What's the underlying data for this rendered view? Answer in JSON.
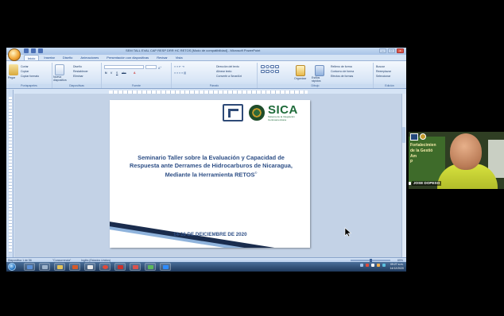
{
  "window": {
    "title": "SEM TALL EVAL CAP RESP DRR HC RETOS [Modo de compatibilidad] - Microsoft PowerPoint",
    "minimize": "–",
    "maximize": "□",
    "close": "x"
  },
  "ribbon": {
    "tabs": [
      "Inicio",
      "Insertar",
      "Diseño",
      "Animaciones",
      "Presentación con diapositivas",
      "Revisar",
      "Vista"
    ],
    "active_tab": "Inicio",
    "groups": {
      "clipboard": {
        "label": "Portapapeles",
        "paste": "Pegar",
        "cut": "Cortar",
        "copy": "Copiar",
        "format_painter": "Copiar formato"
      },
      "slides": {
        "label": "Diapositivas",
        "new_slide": "Nueva diapositiva",
        "layout": "Diseño",
        "reset": "Restablecer",
        "delete": "Eliminar"
      },
      "font": {
        "label": "Fuente"
      },
      "paragraph": {
        "label": "Párrafo",
        "text_direction": "Dirección del texto",
        "align_text": "Alinear texto",
        "smartart": "Convertir a SmartArt"
      },
      "drawing": {
        "label": "Dibujo",
        "arrange": "Organizar",
        "quick_styles": "Estilos rápidos",
        "fill": "Relleno de forma",
        "outline": "Contorno de forma",
        "effects": "Efectos de formas"
      },
      "editing": {
        "label": "Edición",
        "find": "Buscar",
        "replace": "Reemplazar",
        "select": "Seleccionar"
      }
    }
  },
  "slide": {
    "title": "Seminario Taller sobre la Evaluación y Capacidad de Respuesta ante Derrames de Hidrocarburos de Nicaragua, Mediante la Herramienta RETOS",
    "title_mark": "©",
    "date": "14-16 DE DEICIEMBRE DE 2020",
    "logo_sica": "SICA",
    "logo_sica_sub": "Sistema de la Integración Centroamericana"
  },
  "status": {
    "slide_counter": "Diapositiva 1 de 56",
    "theme": "\"Concurrencia\"",
    "language": "Inglés (Estados Unidos)",
    "zoom": "69%"
  },
  "taskbar": {
    "clock_time": "09:27 a.m.",
    "clock_date": "14/12/2020"
  },
  "webcam": {
    "participant_name": "JOSE DOPESO",
    "board_text": "Fortalecimien\nde la Gestió\nAm\nP"
  },
  "colors": {
    "slide_title": "#2e4f86",
    "sica_green": "#1f6b3a",
    "taskbar": "#1f3a5c",
    "ribbon": "#d9e6f6"
  }
}
